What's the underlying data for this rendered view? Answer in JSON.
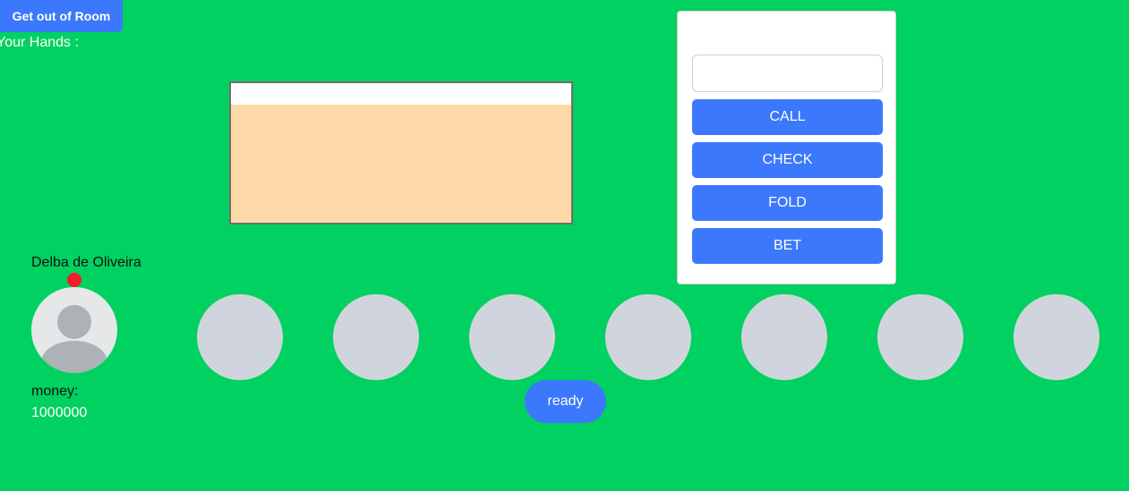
{
  "header": {
    "exit_label": "Get out of Room",
    "hands_label": "Your Hands :"
  },
  "action_panel": {
    "bet_input": {
      "value": "",
      "placeholder": ""
    },
    "buttons": [
      "CALL",
      "CHECK",
      "FOLD",
      "BET"
    ]
  },
  "player": {
    "name": "Delba de Oliveira",
    "money_label": "money:",
    "money": "1000000",
    "avatar_icon": "user-silhouette-icon",
    "turn_indicator_color": "#f01d2b"
  },
  "empty_seats": 7,
  "ready_label": "ready",
  "colors": {
    "table": "#00d160",
    "accent": "#3b78fb",
    "board": "#fdd9a8",
    "seat": "#d0d5dd"
  }
}
